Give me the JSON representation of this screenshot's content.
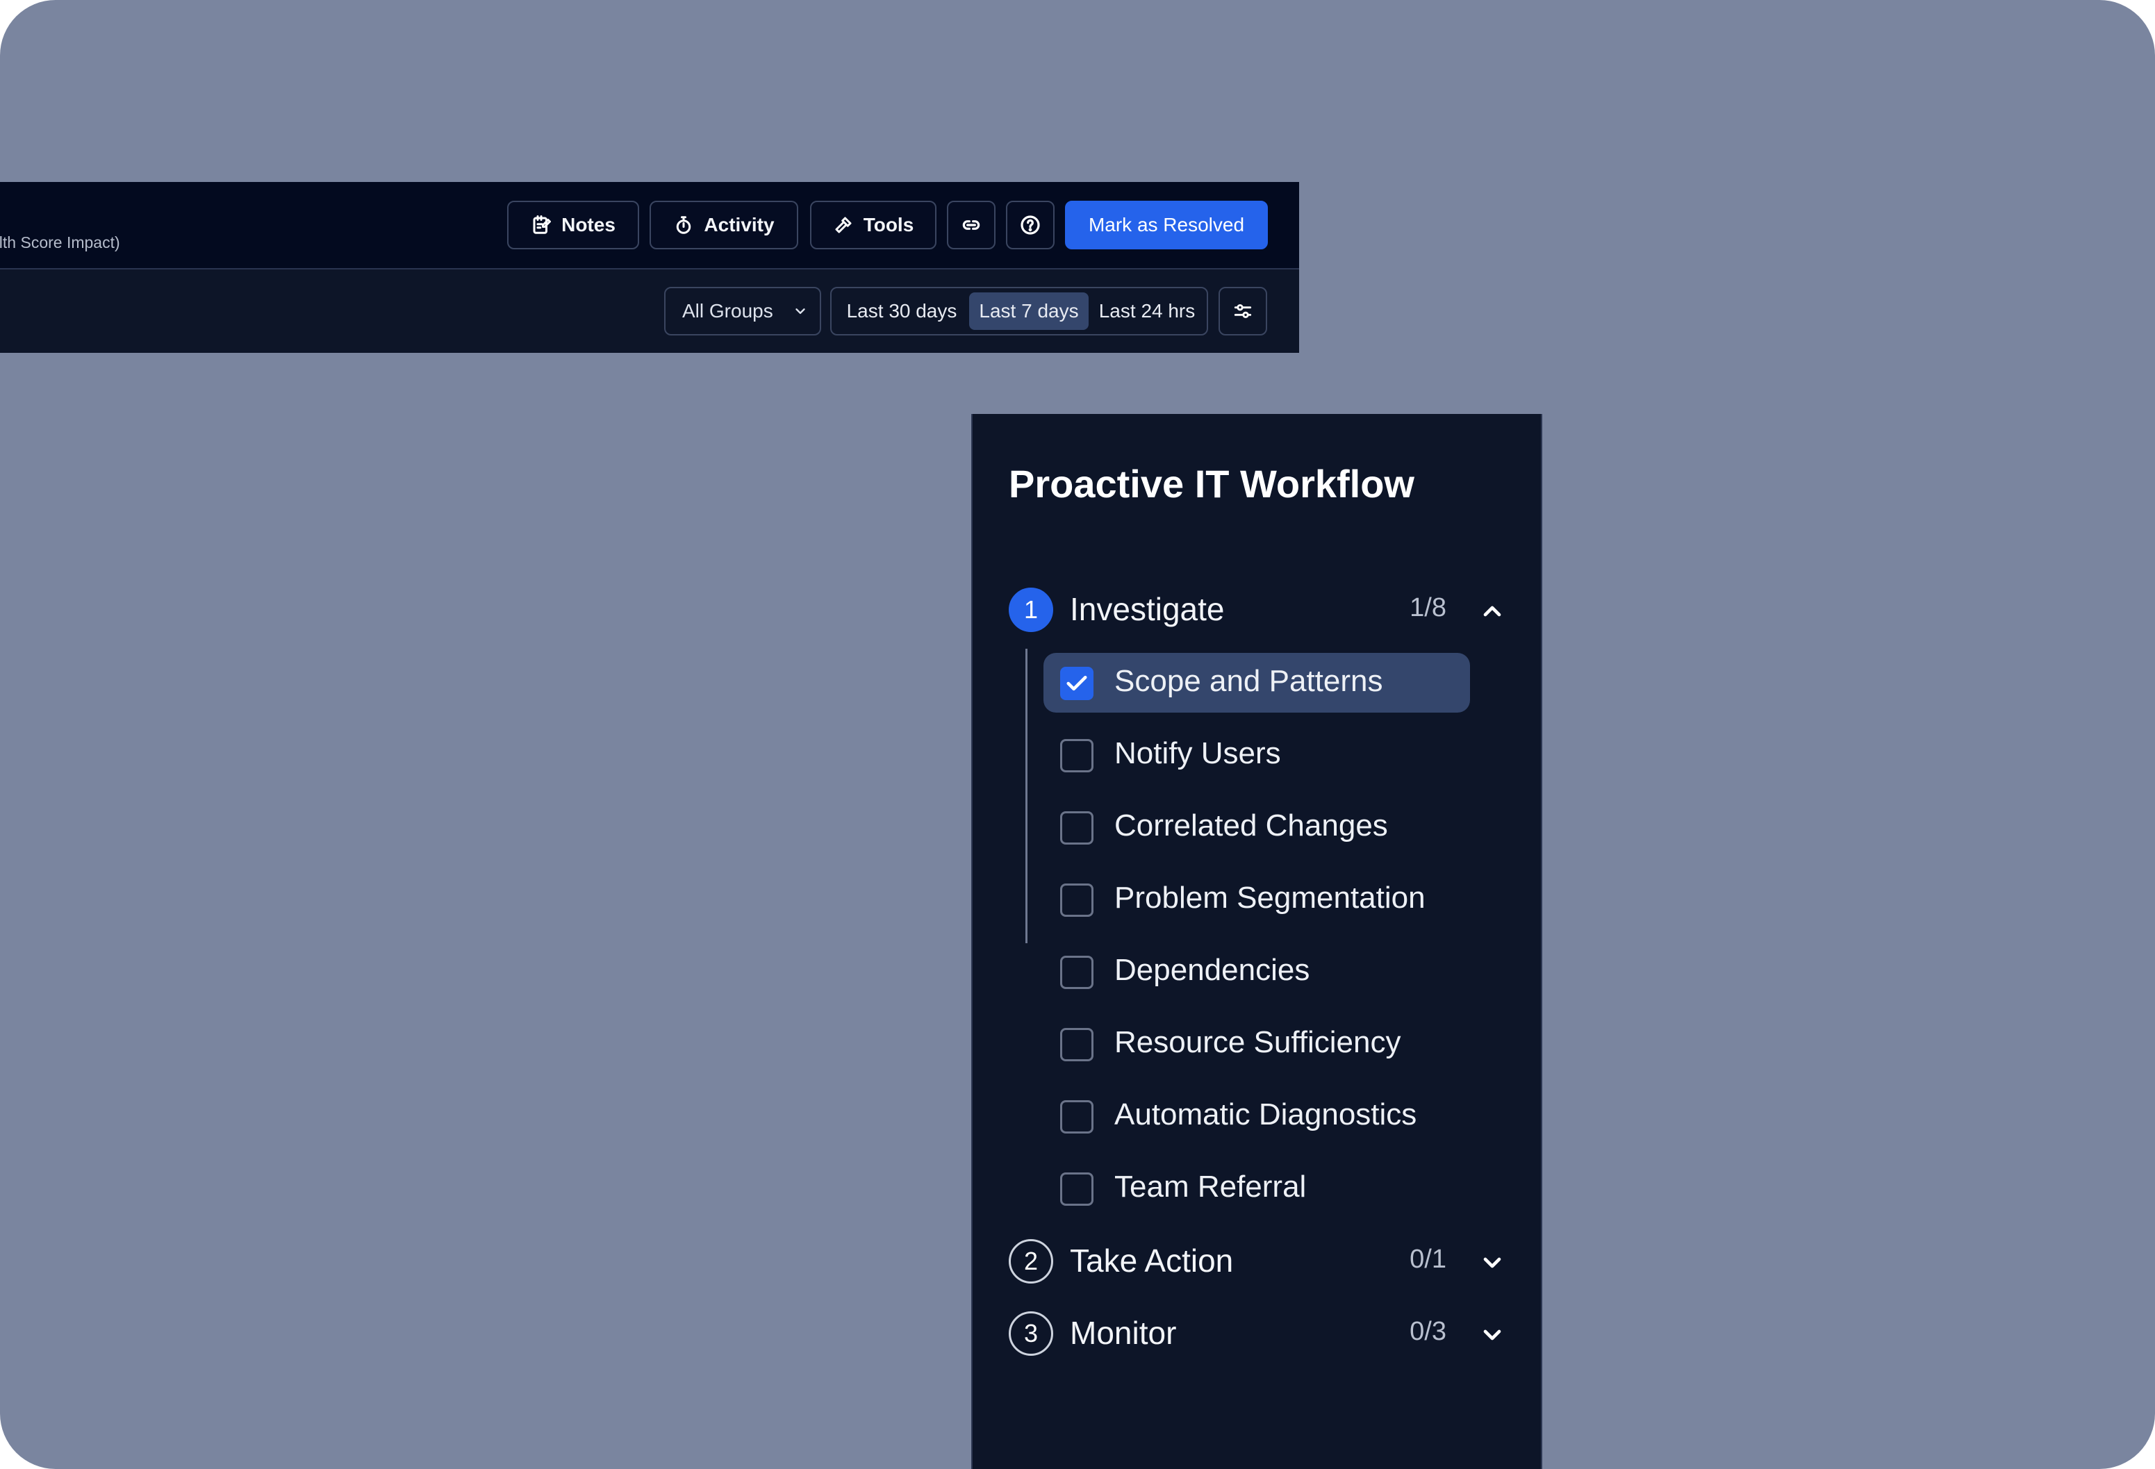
{
  "header": {
    "subtitle": "alth Score Impact)",
    "buttons": {
      "notes": "Notes",
      "activity": "Activity",
      "tools": "Tools",
      "resolve": "Mark as Resolved"
    },
    "icons": {
      "notes": "notes-icon",
      "activity": "stopwatch-icon",
      "tools": "hammer-icon",
      "link": "link-icon",
      "help": "help-circle-icon",
      "filter": "sliders-icon"
    }
  },
  "filters": {
    "groups_select": "All Groups",
    "ranges": [
      "Last 30 days",
      "Last 7 days",
      "Last 24 hrs"
    ],
    "active_range": "Last 7 days"
  },
  "workflow": {
    "title": "Proactive IT Workflow",
    "stages": [
      {
        "num": "1",
        "label": "Investigate",
        "count": "1/8",
        "expanded": true,
        "tasks": [
          {
            "label": "Scope and Patterns",
            "checked": true
          },
          {
            "label": "Notify Users",
            "checked": false
          },
          {
            "label": "Correlated Changes",
            "checked": false
          },
          {
            "label": "Problem Segmentation",
            "checked": false
          },
          {
            "label": "Dependencies",
            "checked": false
          },
          {
            "label": "Resource Sufficiency",
            "checked": false
          },
          {
            "label": "Automatic Diagnostics",
            "checked": false
          },
          {
            "label": "Team Referral",
            "checked": false
          }
        ]
      },
      {
        "num": "2",
        "label": "Take Action",
        "count": "0/1",
        "expanded": false
      },
      {
        "num": "3",
        "label": "Monitor",
        "count": "0/3",
        "expanded": false
      }
    ]
  },
  "colors": {
    "background": "#7a859f",
    "panel": "#0d1528",
    "header": "#030a1f",
    "accent": "#2563eb",
    "active_row": "#34466c"
  }
}
